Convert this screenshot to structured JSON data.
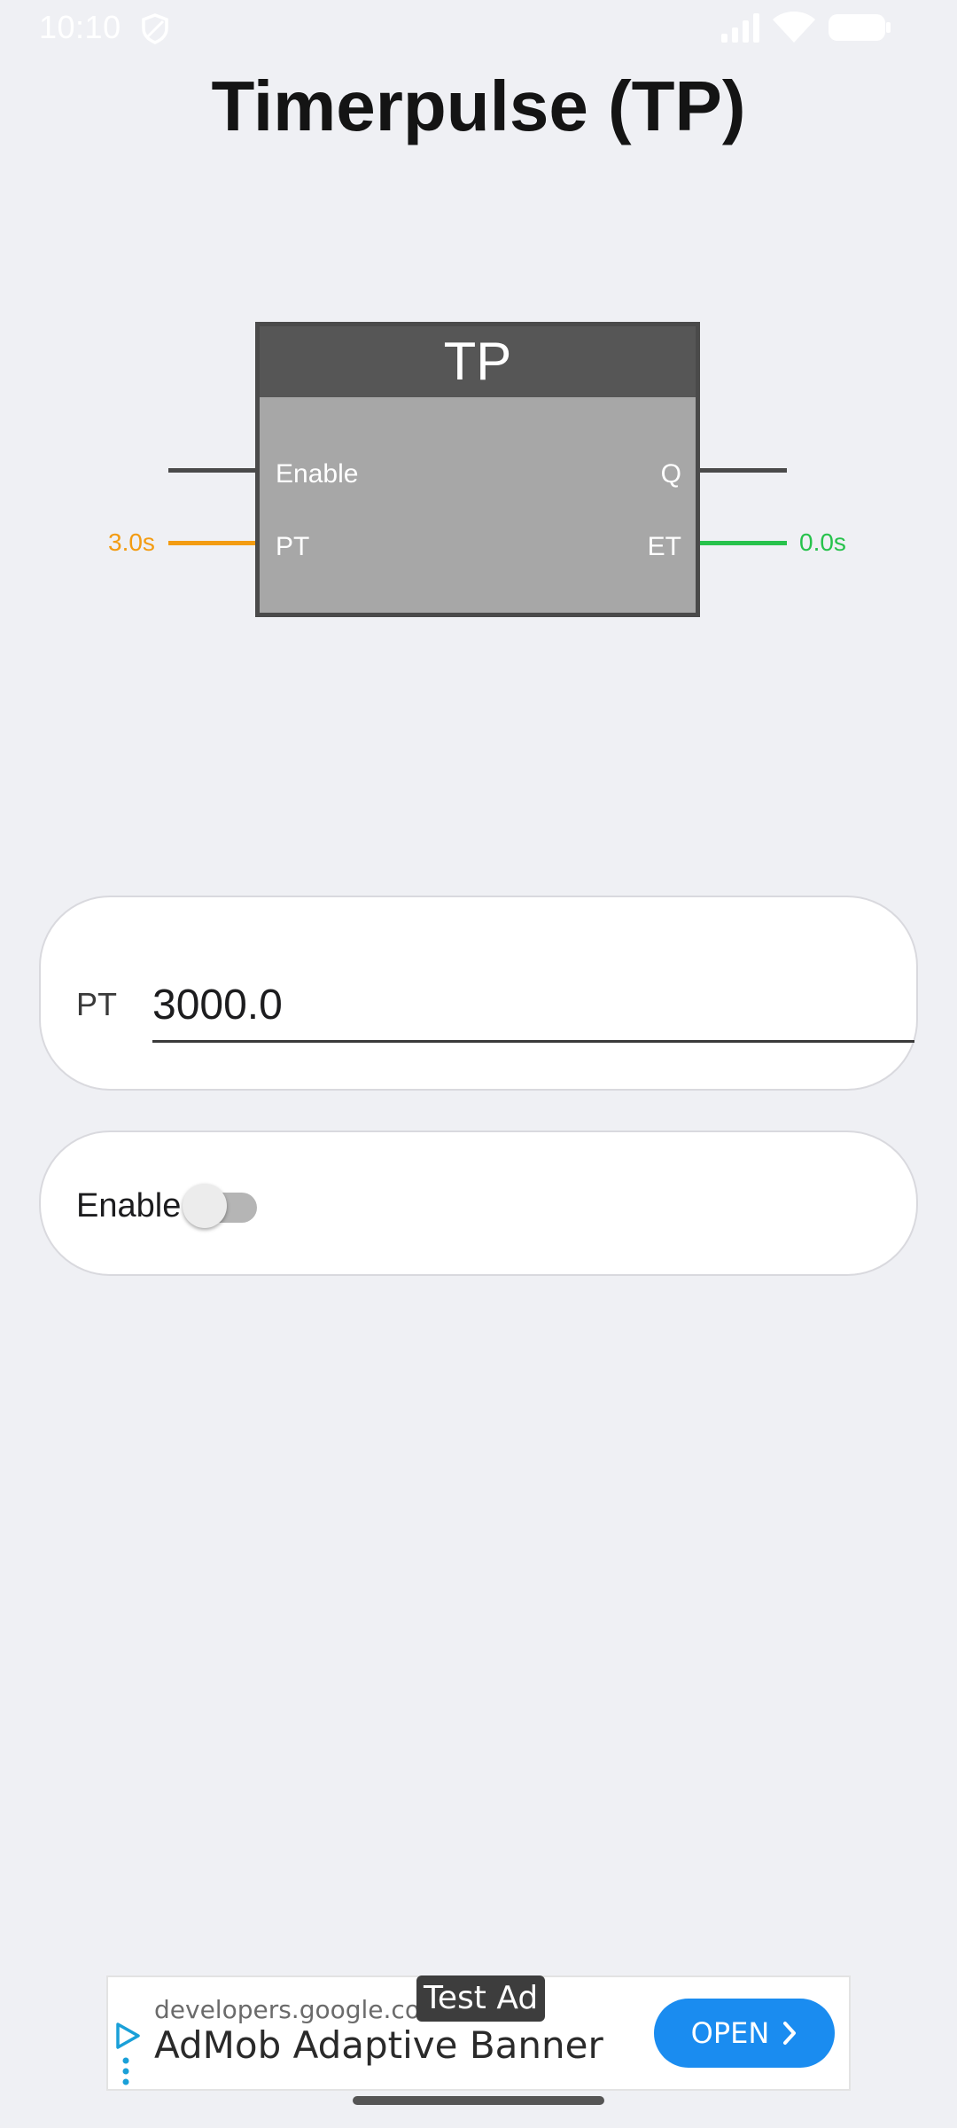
{
  "status_bar": {
    "time": "10:10",
    "icons": [
      "shield-icon",
      "signal-icon",
      "wifi-icon",
      "battery-icon"
    ]
  },
  "title": "Timerpulse (TP)",
  "function_block": {
    "name": "TP",
    "inputs": {
      "enable": "Enable",
      "pt": "PT"
    },
    "outputs": {
      "q": "Q",
      "et": "ET"
    },
    "pt_value": "3.0s",
    "et_value": "0.0s",
    "colors": {
      "header": "#565656",
      "body": "#a7a7a7",
      "pt_wire": "#f39c12",
      "et_wire": "#27c24c"
    }
  },
  "pt_card": {
    "label": "PT",
    "value": "3000.0"
  },
  "enable_card": {
    "label": "Enable",
    "toggle_on": false
  },
  "ad": {
    "domain": "developers.google.com",
    "title": "AdMob Adaptive Banner",
    "badge": "Test Ad",
    "button_label": "OPEN",
    "button_color": "#1a8cf0"
  }
}
